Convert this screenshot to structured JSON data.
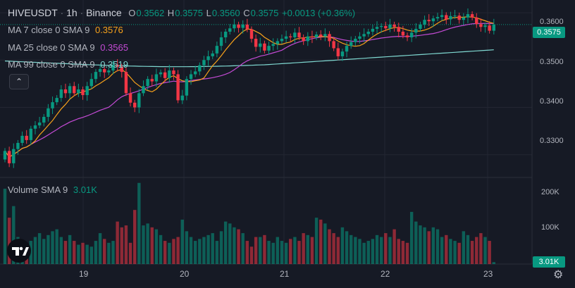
{
  "header": {
    "symbol": "HIVEUSDT",
    "interval": "1h",
    "exchange": "Binance",
    "ohlc": {
      "o_label": "O",
      "o": "0.3562",
      "h_label": "H",
      "h": "0.3575",
      "l_label": "L",
      "l": "0.3560",
      "c_label": "C",
      "c": "0.3575",
      "change": "+0.0013 (+0.36%)"
    }
  },
  "indicators": [
    {
      "label": "MA 7 close 0 SMA 9",
      "value": "0.3576",
      "color": "#f7a21b"
    },
    {
      "label": "MA 25 close 0 SMA 9",
      "value": "0.3565",
      "color": "#c54bd6"
    },
    {
      "label": "MA 99 close 0 SMA 9",
      "value": "0.3519",
      "color": "#7fd8d1"
    }
  ],
  "volume": {
    "label": "Volume SMA 9",
    "value": "3.01K"
  },
  "price_axis": [
    "0.3600",
    "0.3500",
    "0.3400",
    "0.3300"
  ],
  "volume_axis": [
    "200K",
    "100K"
  ],
  "current_price_tag": "0.3575",
  "volume_tag": "3.01K",
  "time_axis": [
    "19",
    "20",
    "21",
    "22",
    "23"
  ],
  "colors": {
    "up": "#089981",
    "down": "#f23645",
    "background": "#161a25"
  },
  "icons": {
    "collapse": "chevron-up-icon",
    "settings": "gear-icon",
    "logo": "tradingview-logo"
  },
  "chart_data": {
    "type": "candlestick",
    "x_range": [
      "18 18:00",
      "23 00:00"
    ],
    "ylim": [
      0.3255,
      0.3615
    ],
    "open": [
      0.329,
      0.3308,
      0.3282,
      0.3312,
      0.3325,
      0.334,
      0.3331,
      0.3355,
      0.3362,
      0.3368,
      0.338,
      0.3398,
      0.3411,
      0.342,
      0.3438,
      0.343,
      0.3445,
      0.343,
      0.3438,
      0.3426,
      0.3445,
      0.346,
      0.3475,
      0.3481,
      0.3474,
      0.3478,
      0.349,
      0.3486,
      0.3475,
      0.343,
      0.341,
      0.34,
      0.343,
      0.3445,
      0.346,
      0.3455,
      0.347,
      0.3474,
      0.3462,
      0.3478,
      0.347,
      0.3415,
      0.3425,
      0.346,
      0.347,
      0.3476,
      0.3489,
      0.35,
      0.3508,
      0.3514,
      0.353,
      0.3548,
      0.356,
      0.3567,
      0.3575,
      0.3568,
      0.3575,
      0.3565,
      0.3545,
      0.3528,
      0.3535,
      0.352,
      0.353,
      0.3534,
      0.354,
      0.3545,
      0.355,
      0.3548,
      0.3558,
      0.3548,
      0.354,
      0.355,
      0.3548,
      0.3554,
      0.355,
      0.3555,
      0.354,
      0.3525,
      0.3508,
      0.3518,
      0.353,
      0.3538,
      0.3545,
      0.355,
      0.3555,
      0.356,
      0.3566,
      0.357,
      0.3572,
      0.3567,
      0.3575,
      0.357,
      0.356,
      0.3552,
      0.3548,
      0.3558,
      0.3566,
      0.3575,
      0.3585,
      0.3582,
      0.3588,
      0.3591,
      0.3595,
      0.3586,
      0.3593,
      0.3594,
      0.3585,
      0.359,
      0.3597,
      0.359,
      0.3576,
      0.357,
      0.3573,
      0.3562
    ],
    "close": [
      0.3308,
      0.3282,
      0.3312,
      0.3325,
      0.334,
      0.3331,
      0.3355,
      0.3362,
      0.3368,
      0.338,
      0.3398,
      0.3411,
      0.342,
      0.3438,
      0.343,
      0.3445,
      0.343,
      0.3438,
      0.3426,
      0.3445,
      0.346,
      0.3475,
      0.3481,
      0.3474,
      0.3478,
      0.349,
      0.3486,
      0.3475,
      0.343,
      0.341,
      0.34,
      0.343,
      0.3445,
      0.346,
      0.3455,
      0.347,
      0.3474,
      0.3462,
      0.3478,
      0.347,
      0.3415,
      0.3425,
      0.346,
      0.347,
      0.3476,
      0.3489,
      0.35,
      0.3508,
      0.3514,
      0.353,
      0.3548,
      0.356,
      0.3567,
      0.3575,
      0.3568,
      0.3575,
      0.3565,
      0.3545,
      0.3528,
      0.3535,
      0.352,
      0.353,
      0.3534,
      0.354,
      0.3545,
      0.355,
      0.3548,
      0.3558,
      0.3548,
      0.354,
      0.355,
      0.3548,
      0.3554,
      0.355,
      0.3555,
      0.354,
      0.3525,
      0.3508,
      0.3518,
      0.353,
      0.3538,
      0.3545,
      0.355,
      0.3555,
      0.356,
      0.3566,
      0.357,
      0.3572,
      0.3567,
      0.3575,
      0.357,
      0.356,
      0.3552,
      0.3548,
      0.3558,
      0.3566,
      0.3575,
      0.3585,
      0.3582,
      0.3588,
      0.3591,
      0.3595,
      0.3586,
      0.3593,
      0.3594,
      0.3585,
      0.359,
      0.3597,
      0.359,
      0.3576,
      0.357,
      0.3573,
      0.3562,
      0.3575
    ],
    "volume": [
      195,
      120,
      150,
      70,
      50,
      45,
      60,
      70,
      80,
      65,
      75,
      85,
      90,
      70,
      60,
      75,
      60,
      50,
      55,
      50,
      45,
      60,
      80,
      65,
      55,
      60,
      110,
      95,
      100,
      55,
      140,
      210,
      100,
      105,
      95,
      90,
      75,
      60,
      55,
      65,
      70,
      115,
      85,
      70,
      60,
      65,
      70,
      75,
      80,
      60,
      85,
      110,
      105,
      95,
      90,
      80,
      60,
      45,
      70,
      70,
      75,
      60,
      55,
      70,
      60,
      55,
      65,
      70,
      60,
      80,
      75,
      70,
      120,
      115,
      105,
      90,
      80,
      70,
      95,
      85,
      75,
      70,
      65,
      55,
      60,
      65,
      75,
      70,
      80,
      70,
      90,
      65,
      60,
      55,
      135,
      110,
      100,
      95,
      85,
      95,
      90,
      70,
      75,
      65,
      60,
      55,
      85,
      75,
      60,
      70,
      80,
      70,
      60,
      5
    ],
    "series": [
      {
        "name": "MA 7 close 0 SMA 9",
        "last": 0.3576
      },
      {
        "name": "MA 25 close 0 SMA 9",
        "last": 0.3565
      },
      {
        "name": "MA 99 close 0 SMA 9",
        "last": 0.3519
      }
    ]
  }
}
